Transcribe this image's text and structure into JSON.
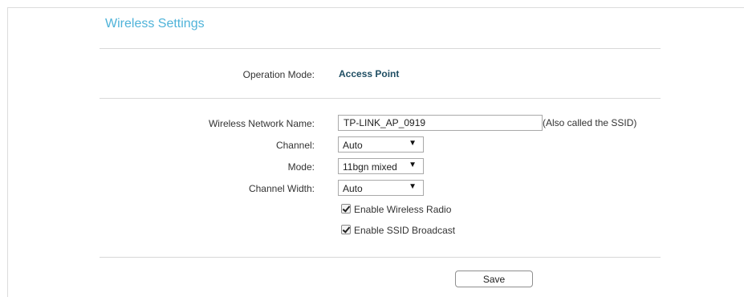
{
  "page": {
    "title": "Wireless Settings"
  },
  "operation_mode": {
    "label": "Operation Mode:",
    "value": "Access Point"
  },
  "form": {
    "network_name": {
      "label": "Wireless Network Name:",
      "value": "TP-LINK_AP_0919",
      "hint": "(Also called the SSID)"
    },
    "channel": {
      "label": "Channel:",
      "value": "Auto"
    },
    "mode": {
      "label": "Mode:",
      "value": "11bgn mixed"
    },
    "channel_width": {
      "label": "Channel Width:",
      "value": "Auto"
    },
    "enable_wireless_radio": {
      "label": "Enable Wireless Radio",
      "checked": true
    },
    "enable_ssid_broadcast": {
      "label": "Enable SSID Broadcast",
      "checked": true
    }
  },
  "actions": {
    "save_label": "Save"
  },
  "icons": {
    "dropdown": "chevron-down-icon",
    "checkbox": "checkmark-icon"
  },
  "colors": {
    "title": "#4fb3d9",
    "operation_mode_value": "#1f4e63",
    "divider": "#d8d8d8"
  }
}
